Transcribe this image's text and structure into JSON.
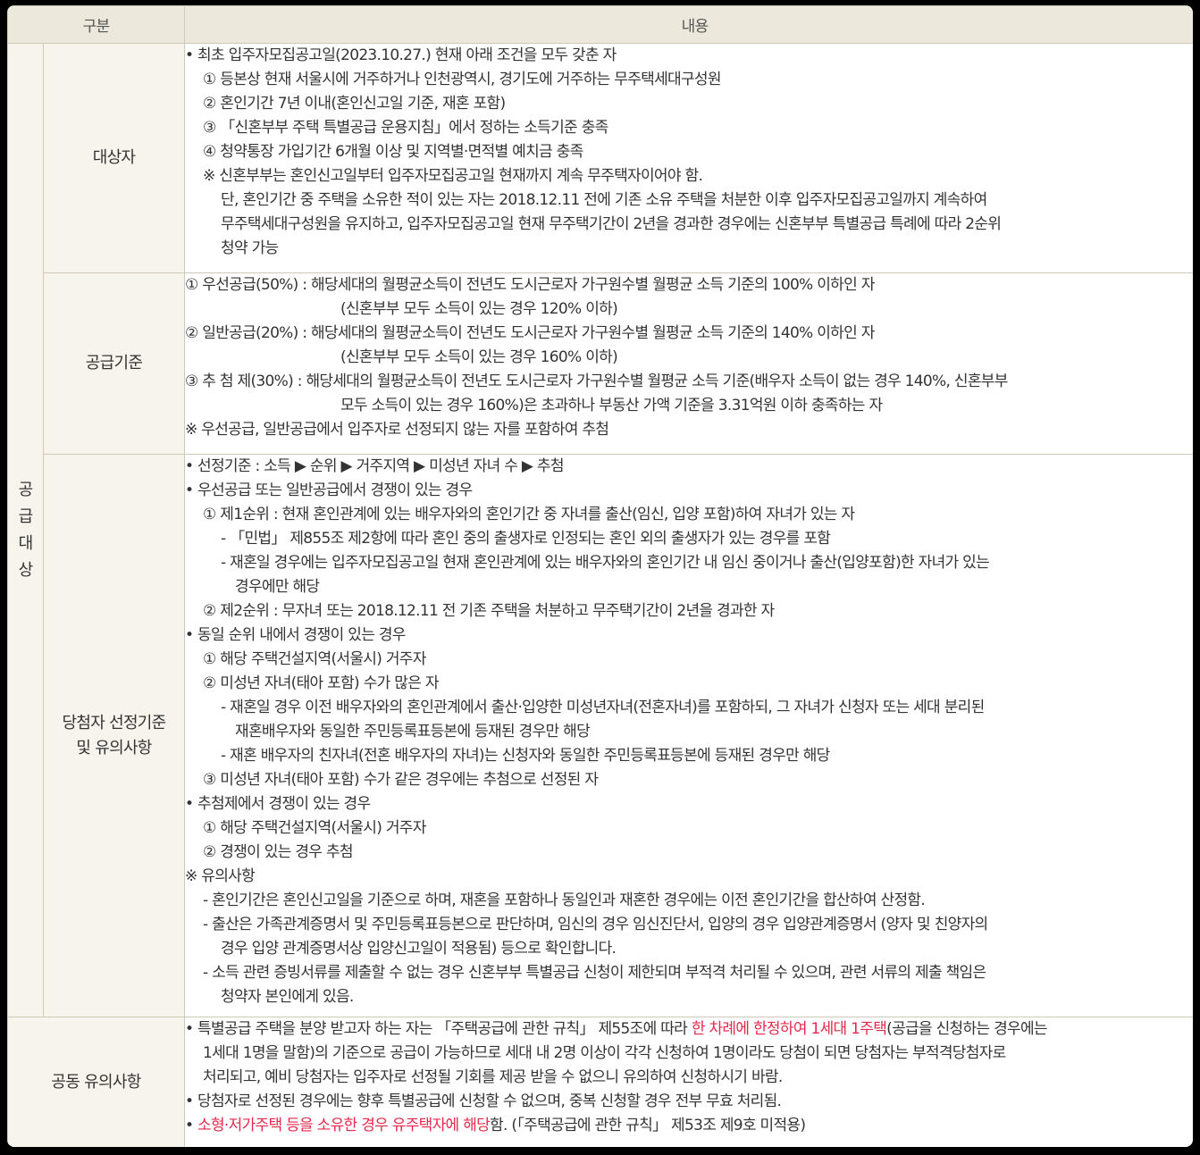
{
  "header": {
    "col1": "구분",
    "col2": "내용"
  },
  "category": "공급대상",
  "sections": {
    "target": {
      "label": "대상자",
      "lines": [
        "• 최초 입주자모집공고일(2023.10.27.) 현재 아래 조건을 모두 갖춘 자",
        "① 등본상 현재 서울시에 거주하거나 인천광역시, 경기도에 거주하는 무주택세대구성원",
        "② 혼인기간 7년 이내(혼인신고일 기준, 재혼 포함)",
        "③ 「신혼부부 주택 특별공급 운용지침」에서 정하는 소득기준 충족",
        "④ 청약통장 가입기간 6개월 이상 및 지역별·면적별 예치금 충족",
        "※ 신혼부부는 혼인신고일부터 입주자모집공고일 현재까지 계속 무주택자이어야 함.",
        "단, 혼인기간 중 주택을 소유한 적이 있는 자는 2018.12.11 전에 기존 소유 주택을 처분한 이후 입주자모집공고일까지 계속하여",
        "무주택세대구성원을 유지하고, 입주자모집공고일 현재 무주택기간이 2년을 경과한 경우에는 신혼부부 특별공급 특례에 따라 2순위",
        "청약 가능"
      ]
    },
    "criteria": {
      "label": "공급기준",
      "lines": [
        "① 우선공급(50%) : 해당세대의 월평균소득이 전년도 도시근로자 가구원수별 월평균 소득 기준의 100% 이하인 자",
        "(신혼부부 모두 소득이 있는 경우 120% 이하)",
        "② 일반공급(20%) : 해당세대의 월평균소득이 전년도 도시근로자 가구원수별 월평균 소득 기준의 140% 이하인 자",
        "(신혼부부 모두 소득이 있는 경우 160% 이하)",
        "③ 추 첨 제(30%) : 해당세대의 월평균소득이 전년도 도시근로자 가구원수별 월평균 소득 기준(배우자 소득이 없는 경우 140%, 신혼부부",
        "모두 소득이 있는 경우 160%)은 초과하나 부동산 가액 기준을 3.31억원 이하 충족하는 자",
        "※ 우선공급, 일반공급에서 입주자로 선정되지 않는 자를 포함하여 추첨"
      ]
    },
    "selection": {
      "label_line1": "당첨자 선정기준",
      "label_line2": "및 유의사항",
      "lines": [
        "• 선정기준 : 소득 ▶ 순위 ▶ 거주지역 ▶ 미성년 자녀 수 ▶ 추첨",
        "• 우선공급 또는 일반공급에서 경쟁이 있는 경우",
        "① 제1순위 : 현재 혼인관계에 있는 배우자와의 혼인기간 중 자녀를 출산(임신, 입양 포함)하여 자녀가 있는 자",
        "- 「민법」 제855조 제2항에 따라 혼인 중의 출생자로 인정되는 혼인 외의 출생자가 있는 경우를 포함",
        "- 재혼일 경우에는 입주자모집공고일 현재 혼인관계에 있는 배우자와의 혼인기간 내 임신 중이거나 출산(입양포함)한 자녀가 있는",
        "경우에만 해당",
        "② 제2순위 : 무자녀 또는 2018.12.11 전 기존 주택을 처분하고 무주택기간이 2년을 경과한 자",
        "• 동일 순위 내에서 경쟁이 있는 경우",
        "① 해당 주택건설지역(서울시) 거주자",
        "② 미성년 자녀(태아 포함) 수가 많은 자",
        "- 재혼일 경우 이전 배우자와의 혼인관계에서 출산·입양한 미성년자녀(전혼자녀)를 포함하되, 그 자녀가 신청자 또는 세대 분리된",
        "재혼배우자와 동일한 주민등록표등본에 등재된 경우만 해당",
        "- 재혼 배우자의 친자녀(전혼 배우자의 자녀)는 신청자와 동일한 주민등록표등본에 등재된 경우만 해당",
        "③ 미성년 자녀(태아 포함) 수가 같은 경우에는 추첨으로 선정된 자",
        "• 추첨제에서 경쟁이 있는 경우",
        "① 해당 주택건설지역(서울시) 거주자",
        "② 경쟁이 있는 경우 추첨",
        "※ 유의사항",
        "- 혼인기간은 혼인신고일을 기준으로 하며, 재혼을 포함하나 동일인과 재혼한 경우에는 이전 혼인기간을 합산하여 산정함.",
        "- 출산은 가족관계증명서 및 주민등록표등본으로 판단하며, 임신의 경우 임신진단서, 입양의 경우 입양관계증명서 (양자 및 친양자의",
        "경우 입양 관계증명서상 입양신고일이 적용됨) 등으로 확인합니다.",
        "- 소득 관련 증빙서류를 제출할 수 없는 경우 신혼부부 특별공급 신청이 제한되며 부적격 처리될 수 있으며, 관련 서류의 제출 책임은",
        "청약자 본인에게 있음."
      ]
    },
    "common": {
      "label": "공동 유의사항",
      "line1_a": "• 특별공급 주택을 분양 받고자 하는 자는 「주택공급에 관한 규칙」 제55조에 따라 ",
      "line1_red": "한 차례에 한정하여 1세대 1주택",
      "line1_b": "(공급을 신청하는 경우에는",
      "line2": "1세대 1명을 말함)의 기준으로 공급이 가능하므로 세대 내 2명 이상이 각각 신청하여 1명이라도 당첨이 되면 당첨자는 부적격당첨자로",
      "line3": "처리되고, 예비 당첨자는 입주자로 선정될 기회를 제공 받을 수 없으니 유의하여 신청하시기 바람.",
      "line4": "• 당첨자로 선정된 경우에는 향후 특별공급에 신청할 수 없으며, 중복 신청할 경우 전부 무효 처리됨.",
      "line5_bullet": "• ",
      "line5_red": "소형·저가주택 등을 소유한 경우 유주택자에 해당",
      "line5_b": "함. (「주택공급에 관한 규칙」 제53조 제9호 미적용)"
    }
  }
}
